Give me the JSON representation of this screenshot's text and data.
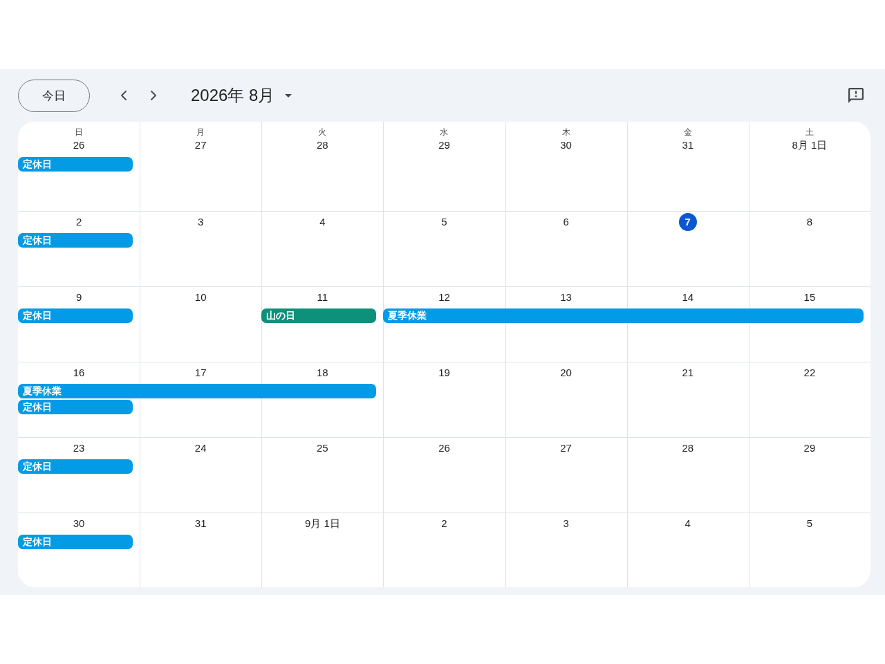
{
  "toolbar": {
    "today_button": "今日",
    "title": "2026年 8月"
  },
  "weeks": [
    {
      "days": [
        {
          "weekday": "日",
          "label": "26",
          "today": false,
          "events": [
            {
              "kind": "event",
              "title": "定休日",
              "color": "#039be5"
            }
          ]
        },
        {
          "weekday": "月",
          "label": "27",
          "today": false
        },
        {
          "weekday": "火",
          "label": "28",
          "today": false
        },
        {
          "weekday": "水",
          "label": "29",
          "today": false
        },
        {
          "weekday": "木",
          "label": "30",
          "today": false
        },
        {
          "weekday": "金",
          "label": "31",
          "today": false
        },
        {
          "weekday": "土",
          "label": "8月 1日",
          "today": false
        }
      ]
    },
    {
      "days": [
        {
          "label": "2",
          "today": false,
          "events": [
            {
              "kind": "event",
              "title": "定休日",
              "color": "#039be5"
            }
          ]
        },
        {
          "label": "3",
          "today": false
        },
        {
          "label": "4",
          "today": false
        },
        {
          "label": "5",
          "today": false
        },
        {
          "label": "6",
          "today": false
        },
        {
          "label": "7",
          "today": true
        },
        {
          "label": "8",
          "today": false
        }
      ]
    },
    {
      "days": [
        {
          "label": "9",
          "today": false,
          "events": [
            {
              "kind": "event",
              "title": "定休日",
              "color": "#039be5"
            }
          ]
        },
        {
          "label": "10",
          "today": false
        },
        {
          "label": "11",
          "today": false,
          "events": [
            {
              "kind": "event",
              "title": "山の日",
              "color": "#0d917a"
            }
          ]
        },
        {
          "label": "12",
          "today": false,
          "events": [
            {
              "kind": "event",
              "title": "夏季休業",
              "color": "#039be5"
            }
          ]
        },
        {
          "label": "13",
          "today": false,
          "events": [
            {
              "kind": "continuation"
            }
          ]
        },
        {
          "label": "14",
          "today": false,
          "events": [
            {
              "kind": "continuation"
            }
          ]
        },
        {
          "label": "15",
          "today": false,
          "events": [
            {
              "kind": "continuation"
            }
          ]
        }
      ]
    },
    {
      "days": [
        {
          "label": "16",
          "today": false,
          "events": [
            {
              "kind": "event",
              "title": "夏季休業",
              "color": "#039be5"
            },
            {
              "kind": "event",
              "title": "定休日",
              "color": "#039be5"
            }
          ]
        },
        {
          "label": "17",
          "today": false,
          "events": [
            {
              "kind": "continuation"
            }
          ]
        },
        {
          "label": "18",
          "today": false,
          "events": [
            {
              "kind": "continuation"
            }
          ]
        },
        {
          "label": "19",
          "today": false
        },
        {
          "label": "20",
          "today": false
        },
        {
          "label": "21",
          "today": false
        },
        {
          "label": "22",
          "today": false
        }
      ]
    },
    {
      "days": [
        {
          "label": "23",
          "today": false,
          "events": [
            {
              "kind": "event",
              "title": "定休日",
              "color": "#039be5"
            }
          ]
        },
        {
          "label": "24",
          "today": false
        },
        {
          "label": "25",
          "today": false
        },
        {
          "label": "26",
          "today": false
        },
        {
          "label": "27",
          "today": false
        },
        {
          "label": "28",
          "today": false
        },
        {
          "label": "29",
          "today": false
        }
      ]
    },
    {
      "days": [
        {
          "label": "30",
          "today": false,
          "events": [
            {
              "kind": "event",
              "title": "定休日",
              "color": "#039be5"
            }
          ]
        },
        {
          "label": "31",
          "today": false
        },
        {
          "label": "9月 1日",
          "today": false
        },
        {
          "label": "2",
          "today": false
        },
        {
          "label": "3",
          "today": false
        },
        {
          "label": "4",
          "today": false
        },
        {
          "label": "5",
          "today": false
        }
      ]
    }
  ]
}
